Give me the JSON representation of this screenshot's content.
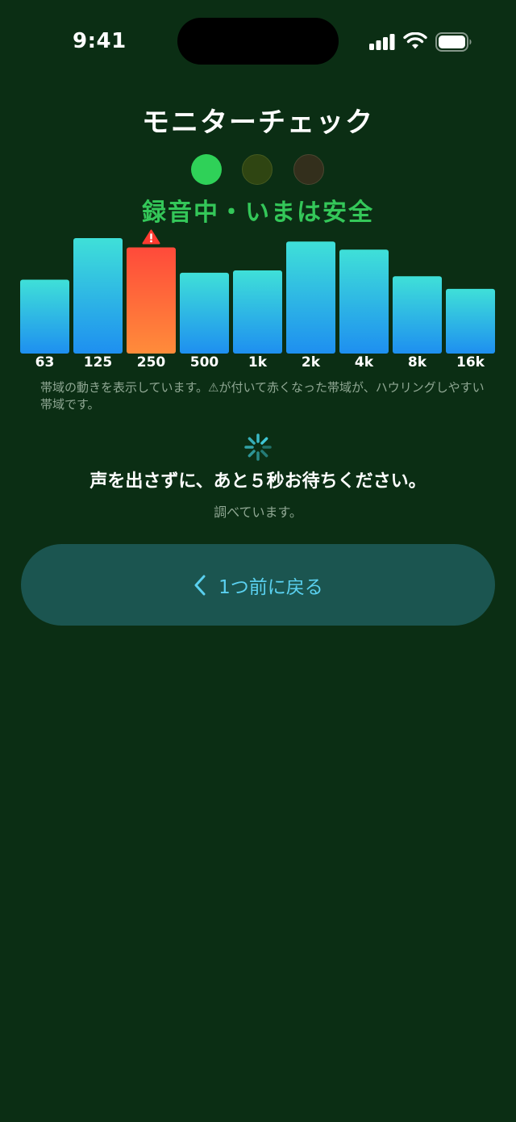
{
  "status": {
    "time": "9:41"
  },
  "header": {
    "title": "モニターチェック"
  },
  "steps": [
    "active",
    "pending",
    "pending"
  ],
  "state_label": "録音中・いまは安全",
  "chart_data": {
    "type": "bar",
    "categories": [
      "63",
      "125",
      "250",
      "500",
      "1k",
      "2k",
      "4k",
      "8k",
      "16k"
    ],
    "values": [
      0.64,
      1.0,
      0.92,
      0.7,
      0.72,
      0.97,
      0.9,
      0.67,
      0.56
    ],
    "warning_band": "250",
    "ylim": [
      0,
      1
    ]
  },
  "caption": "帯域の動きを表示しています。⚠が付いて赤くなった帯域が、ハウリングしやすい帯域です。",
  "wait": {
    "message": "声を出さずに、あと５秒お待ちください。",
    "sub": "調べています。"
  },
  "back_button": {
    "label": "1つ前に戻る"
  },
  "colors": {
    "background": "#0b2e14",
    "accent_green": "#34c759",
    "bar_top": "#3fe0d8",
    "bar_bottom": "#1e8ff0",
    "warn_top": "#ff4a3a",
    "warn_bottom": "#ff8c3a",
    "button_bg": "#1b5550",
    "button_text": "#5ad0ef"
  }
}
